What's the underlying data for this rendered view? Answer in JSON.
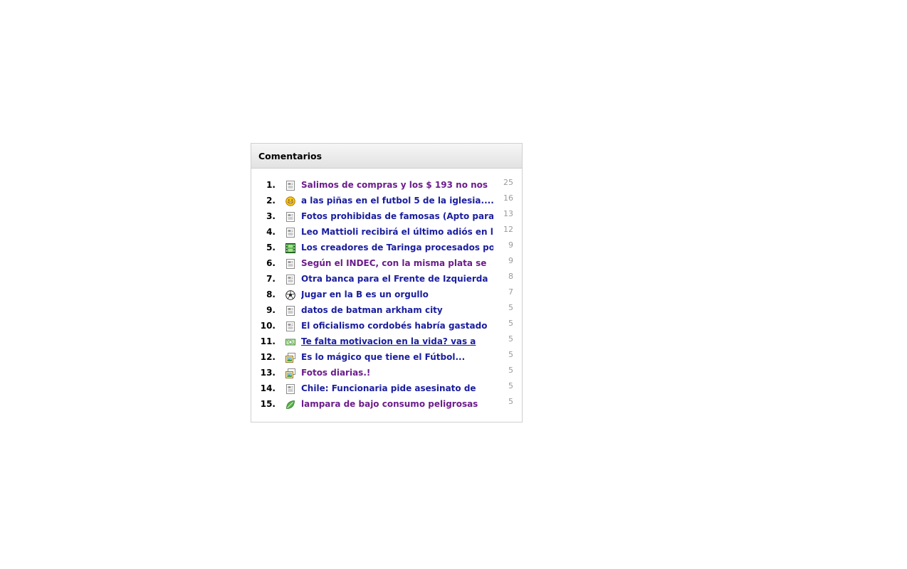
{
  "widget": {
    "title": "Comentarios",
    "items": [
      {
        "rank": "1.",
        "icon": "document-icon",
        "title": "Salimos de compras y los $ 193 no nos",
        "count": "25",
        "visited": true
      },
      {
        "rank": "2.",
        "icon": "smiley-icon",
        "title": "a las piñas en el futbol 5 de la iglesia....",
        "count": "16",
        "visited": false
      },
      {
        "rank": "3.",
        "icon": "document-icon",
        "title": "Fotos prohibidas de famosas (Apto para",
        "count": "13",
        "visited": false
      },
      {
        "rank": "4.",
        "icon": "document-icon",
        "title": "Leo Mattioli recibirá el último adiós en la",
        "count": "12",
        "visited": false
      },
      {
        "rank": "5.",
        "icon": "film-icon",
        "title": "Los creadores de Taringa procesados por",
        "count": "9",
        "visited": false
      },
      {
        "rank": "6.",
        "icon": "document-icon",
        "title": "Según el INDEC, con la misma plata se",
        "count": "9",
        "visited": true
      },
      {
        "rank": "7.",
        "icon": "document-icon",
        "title": "Otra banca para el Frente de Izquierda",
        "count": "8",
        "visited": false
      },
      {
        "rank": "8.",
        "icon": "soccer-ball-icon",
        "title": "Jugar en la B es un orgullo",
        "count": "7",
        "visited": false
      },
      {
        "rank": "9.",
        "icon": "document-icon",
        "title": "datos de batman arkham city",
        "count": "5",
        "visited": false
      },
      {
        "rank": "10.",
        "icon": "document-icon",
        "title": "El oficialismo cordobés habría gastado",
        "count": "5",
        "visited": false
      },
      {
        "rank": "11.",
        "icon": "money-icon",
        "title": "Te falta motivacion en la vida? vas a",
        "count": "5",
        "visited": false,
        "hover": true
      },
      {
        "rank": "12.",
        "icon": "images-icon",
        "title": "Es lo mágico que tiene el Fútbol...",
        "count": "5",
        "visited": false
      },
      {
        "rank": "13.",
        "icon": "images-icon",
        "title": "Fotos diarias.!",
        "count": "5",
        "visited": true
      },
      {
        "rank": "14.",
        "icon": "document-icon",
        "title": "Chile: Funcionaria pide asesinato de",
        "count": "5",
        "visited": false
      },
      {
        "rank": "15.",
        "icon": "leaf-icon",
        "title": "lampara de bajo consumo peligrosas",
        "count": "5",
        "visited": true
      }
    ]
  },
  "colors": {
    "link": "#1a1e9e",
    "link_visited": "#6c1d8c",
    "count": "#9a9a9a"
  }
}
